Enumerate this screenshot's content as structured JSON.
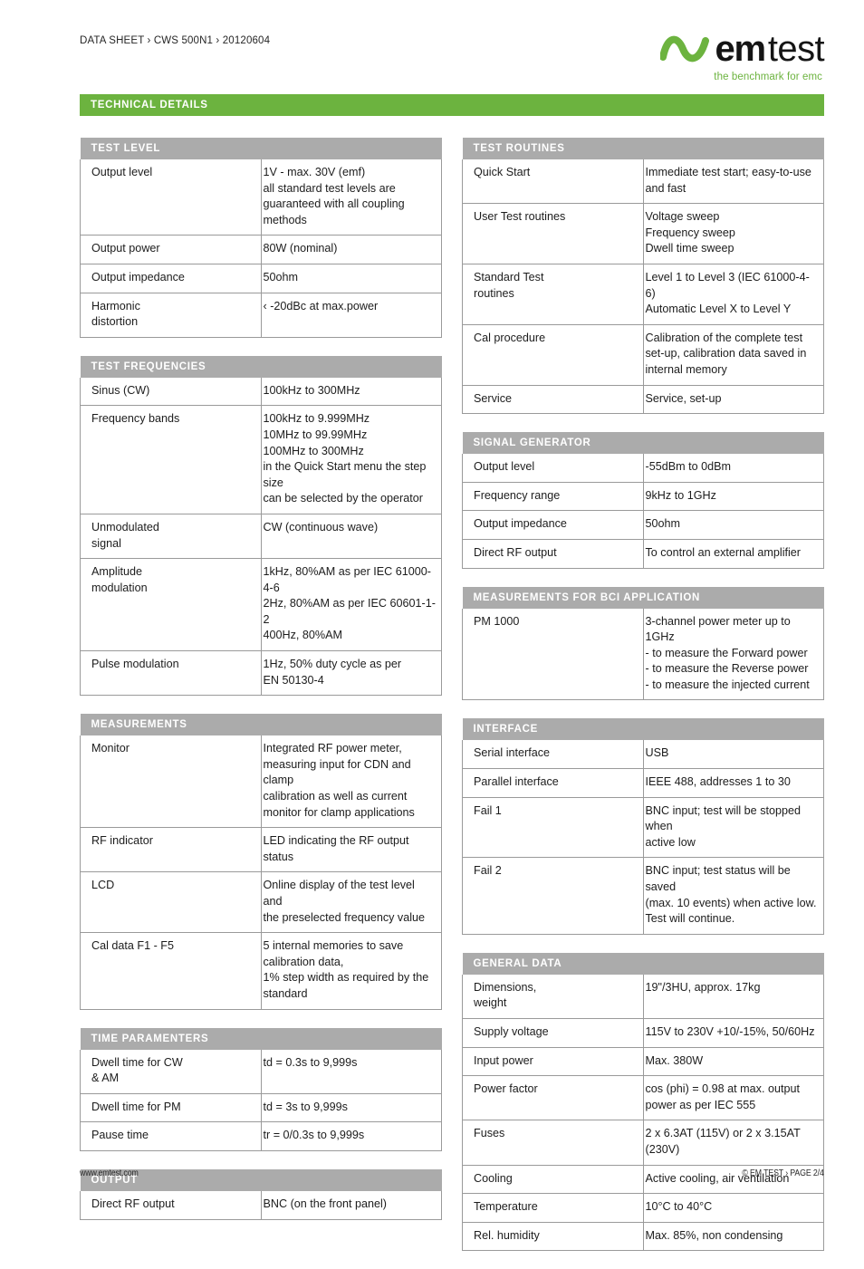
{
  "header": {
    "breadcrumb": "DATA SHEET › CWS 500N1 › 20120604",
    "logo_em": "em",
    "logo_test": "test",
    "logo_tagline": "the benchmark for emc"
  },
  "banner": {
    "title": "TECHNICAL DETAILS"
  },
  "colors": {
    "brand_green": "#6CB33F",
    "header_gray": "#ABABAB",
    "rule_gray": "#9A9A9A",
    "text": "#1C1C1C"
  },
  "left_column": [
    {
      "title": "TEST LEVEL",
      "rows": [
        {
          "key": "Output level",
          "value": "1V - max. 30V (emf)\nall standard test levels are\nguaranteed with all coupling\nmethods"
        },
        {
          "key": "Output power",
          "value": "80W (nominal)"
        },
        {
          "key": "Output impedance",
          "value": "50ohm"
        },
        {
          "key": "Harmonic\ndistortion",
          "value": "‹ -20dBc at max.power"
        }
      ]
    },
    {
      "title": "TEST FREQUENCIES",
      "rows": [
        {
          "key": "Sinus (CW)",
          "value": "100kHz to 300MHz"
        },
        {
          "key": "Frequency bands",
          "value": "100kHz to 9.999MHz\n10MHz to 99.99MHz\n100MHz to 300MHz\nin the Quick Start menu the step size\ncan be selected by the operator"
        },
        {
          "key": "Unmodulated\nsignal",
          "value": "CW (continuous wave)"
        },
        {
          "key": "Amplitude\nmodulation",
          "value": "1kHz, 80%AM as per IEC 61000-4-6\n2Hz, 80%AM as per IEC 60601-1-2\n400Hz, 80%AM"
        },
        {
          "key": "Pulse modulation",
          "value": "1Hz, 50% duty cycle as per\nEN 50130-4"
        }
      ]
    },
    {
      "title": "MEASUREMENTS",
      "rows": [
        {
          "key": "Monitor",
          "value": "Integrated RF power meter,\nmeasuring input for CDN and clamp\ncalibration as well as current\nmonitor for clamp applications"
        },
        {
          "key": "RF indicator",
          "value": "LED indicating the RF output status"
        },
        {
          "key": "LCD",
          "value": "Online display of the test level and\nthe preselected frequency value"
        },
        {
          "key": "Cal data F1 - F5",
          "value": "5 internal memories to save\ncalibration data,\n1% step width as required by the\nstandard"
        }
      ]
    },
    {
      "title": "TIME PARAMENTERS",
      "rows": [
        {
          "key": "Dwell time for CW\n& AM",
          "value": "td = 0.3s to 9,999s"
        },
        {
          "key": "Dwell time for PM",
          "value": "td = 3s to 9,999s"
        },
        {
          "key": "Pause time",
          "value": "tr = 0/0.3s to 9,999s"
        }
      ]
    },
    {
      "title": "OUTPUT",
      "rows": [
        {
          "key": "Direct RF output",
          "value": "BNC (on the front panel)"
        }
      ]
    }
  ],
  "right_column": [
    {
      "title": "TEST ROUTINES",
      "rows": [
        {
          "key": "Quick Start",
          "value": "Immediate test start; easy-to-use\nand fast"
        },
        {
          "key": "User Test routines",
          "value": "Voltage sweep\nFrequency sweep\nDwell time sweep"
        },
        {
          "key": "Standard Test\nroutines",
          "value": "Level 1 to Level 3 (IEC 61000-4-6)\nAutomatic Level X to Level Y"
        },
        {
          "key": "Cal procedure",
          "value": "Calibration of the complete test\nset-up, calibration data saved in\ninternal memory"
        },
        {
          "key": "Service",
          "value": "Service, set-up"
        }
      ]
    },
    {
      "title": "SIGNAL GENERATOR",
      "rows": [
        {
          "key": "Output level",
          "value": "-55dBm to 0dBm"
        },
        {
          "key": "Frequency range",
          "value": "9kHz to 1GHz"
        },
        {
          "key": "Output impedance",
          "value": "50ohm"
        },
        {
          "key": "Direct RF output",
          "value": "To control an external amplifier"
        }
      ]
    },
    {
      "title": "MEASUREMENTS FOR BCI APPLICATION",
      "rows": [
        {
          "key": "PM 1000",
          "value": "3-channel power meter up to 1GHz\n- to measure the Forward power\n- to measure the Reverse power\n- to measure the injected current"
        }
      ]
    },
    {
      "title": "INTERFACE",
      "rows": [
        {
          "key": "Serial interface",
          "value": "USB"
        },
        {
          "key": "Parallel interface",
          "value": "IEEE 488, addresses 1 to 30"
        },
        {
          "key": "Fail 1",
          "value": "BNC input; test will be stopped when\nactive low"
        },
        {
          "key": "Fail 2",
          "value": "BNC input; test status will be saved\n(max. 10 events) when active low.\nTest will continue."
        }
      ]
    },
    {
      "title": "GENERAL DATA",
      "rows": [
        {
          "key": "Dimensions,\nweight",
          "value": "19\"/3HU, approx. 17kg"
        },
        {
          "key": "Supply voltage",
          "value": "115V to 230V +10/-15%, 50/60Hz"
        },
        {
          "key": "Input power",
          "value": "Max. 380W"
        },
        {
          "key": "Power factor",
          "value": "cos (phi) = 0.98 at max. output\npower as per IEC 555"
        },
        {
          "key": "Fuses",
          "value": "2 x 6.3AT (115V) or 2 x 3.15AT\n(230V)"
        },
        {
          "key": "Cooling",
          "value": "Active cooling, air ventilation"
        },
        {
          "key": "Temperature",
          "value": "10°C to 40°C"
        },
        {
          "key": "Rel. humidity",
          "value": "Max. 85%, non condensing"
        }
      ]
    }
  ],
  "footer": {
    "website": "www.emtest.com",
    "copyright": "© EM TEST › PAGE 2/4"
  }
}
